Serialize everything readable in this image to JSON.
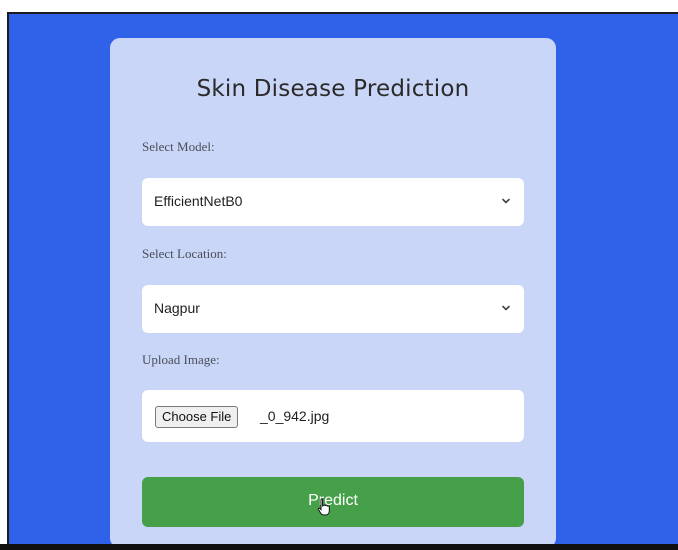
{
  "page": {
    "title": "Skin Disease Prediction"
  },
  "model": {
    "label": "Select Model:",
    "selected": "EfficientNetB0"
  },
  "location": {
    "label": "Select Location:",
    "selected": "Nagpur"
  },
  "upload": {
    "label": "Upload Image:",
    "button_label": "Choose File",
    "file_name": "_0_942.jpg"
  },
  "predict": {
    "label": "Predict"
  },
  "colors": {
    "background": "#2f62e9",
    "card": "#c9d6f7",
    "predict_button": "#45a049"
  },
  "icons": {
    "select_arrow": "chevron-down-icon",
    "cursor": "hand-pointer-icon"
  }
}
